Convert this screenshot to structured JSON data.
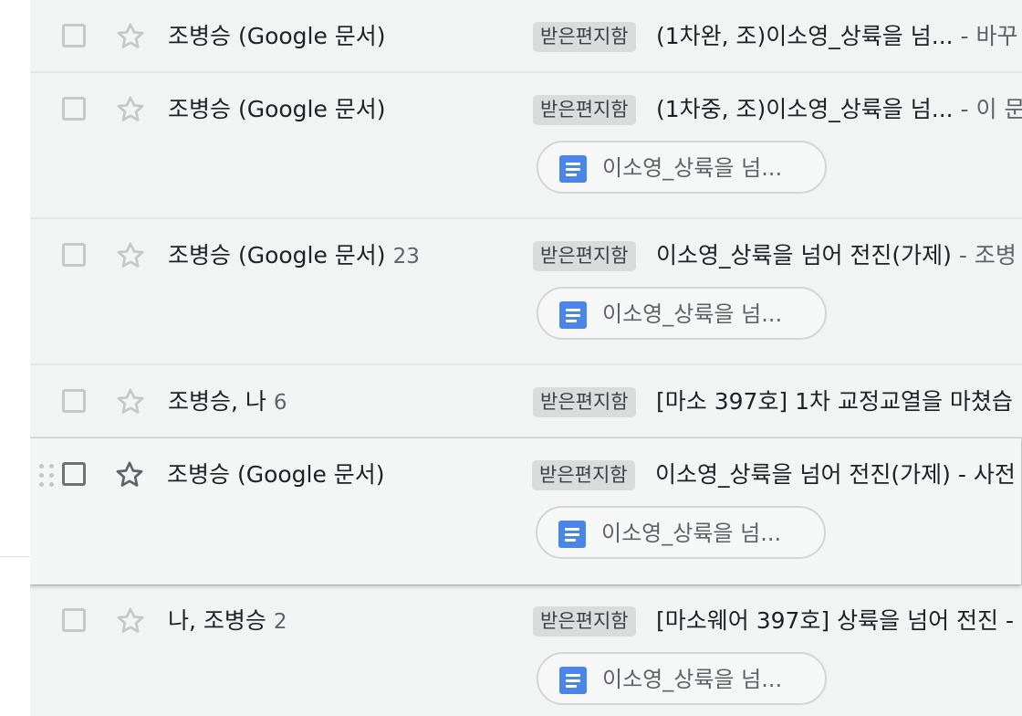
{
  "mailbox": {
    "rows": [
      {
        "sender": "조병승 (Google 문서)",
        "count": "",
        "label": "받은편지함",
        "subject": "(1차완, 조)이소영_상륙을 넘...",
        "snippet": " - 바꾸",
        "attachment": ""
      },
      {
        "sender": "조병승 (Google 문서)",
        "count": "",
        "label": "받은편지함",
        "subject": "(1차중, 조)이소영_상륙을 넘...",
        "snippet": " - 이 문",
        "attachment": "이소영_상륙을 넘..."
      },
      {
        "sender": "조병승 (Google 문서)",
        "count": "23",
        "label": "받은편지함",
        "subject": "이소영_상륙을 넘어 전진(가제)",
        "snippet": " - 조병",
        "attachment": "이소영_상륙을 넘..."
      },
      {
        "sender": "조병승, 나",
        "count": "6",
        "label": "받은편지함",
        "subject": "[마소 397호] 1차 교정교열을 마쳤습",
        "snippet": "",
        "attachment": ""
      },
      {
        "sender": "조병승 (Google 문서)",
        "count": "",
        "label": "받은편지함",
        "subject": "이소영_상륙을 넘어 전진(가제) - 사전",
        "snippet": "",
        "attachment": "이소영_상륙을 넘..."
      },
      {
        "sender": "나, 조병승",
        "count": "2",
        "label": "받은편지함",
        "subject": "[마소웨어 397호] 상륙을 넘어 전진 -",
        "snippet": "",
        "attachment": "이소영_상륙을 넘..."
      }
    ]
  },
  "icons": {
    "star": "star-outline-icon",
    "doc": "google-docs-icon",
    "drag": "drag-handle-icon"
  },
  "colors": {
    "list_bg": "#f2f4f4",
    "label_chip_bg": "#dadcdc",
    "doc_icon": "#4a86e8",
    "star_outline": "#c6c8c8"
  }
}
